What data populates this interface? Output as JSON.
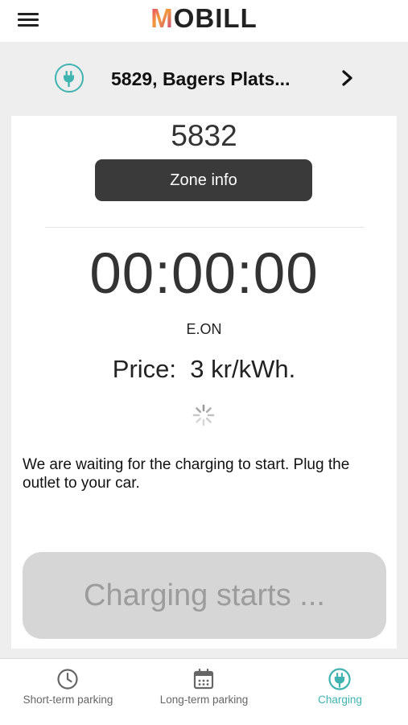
{
  "app": {
    "logo": "MOBILL"
  },
  "zone_header": {
    "title": "5829, Bagers Plats...",
    "icon": "ev-plug-icon",
    "accent_color": "#3fb3b0"
  },
  "session": {
    "zone_code": "5832",
    "zone_info_label": "Zone info",
    "timer": "00:00:00",
    "operator": "E.ON",
    "price_label": "Price:",
    "price_value": "3 kr/kWh.",
    "status_message": "We are waiting for the charging to start. Plug the outlet to your car.",
    "start_button_label": "Charging starts ..."
  },
  "tabs": [
    {
      "label": "Short-term parking",
      "icon": "clock-icon",
      "active": false
    },
    {
      "label": "Long-term parking",
      "icon": "calendar-icon",
      "active": false
    },
    {
      "label": "Charging",
      "icon": "ev-plug-icon",
      "active": true
    }
  ]
}
